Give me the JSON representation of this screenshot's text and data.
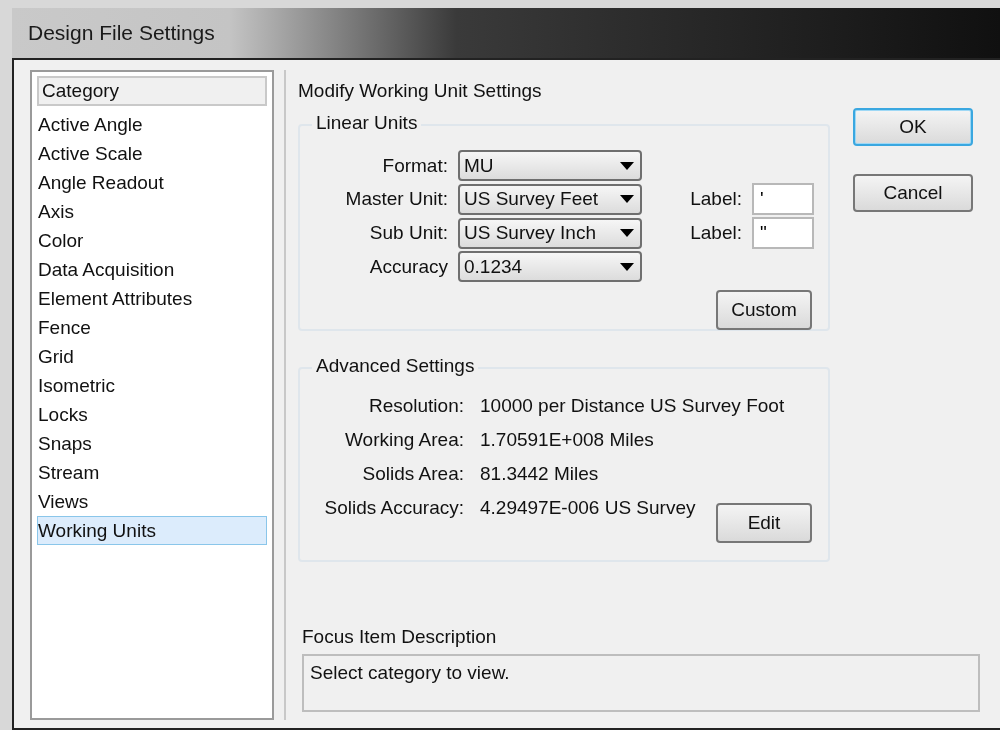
{
  "window": {
    "title": "Design File Settings"
  },
  "category_list": {
    "header": "Category",
    "items": [
      {
        "label": "Active Angle",
        "selected": false
      },
      {
        "label": "Active Scale",
        "selected": false
      },
      {
        "label": "Angle Readout",
        "selected": false
      },
      {
        "label": "Axis",
        "selected": false
      },
      {
        "label": "Color",
        "selected": false
      },
      {
        "label": "Data Acquisition",
        "selected": false
      },
      {
        "label": "Element Attributes",
        "selected": false
      },
      {
        "label": "Fence",
        "selected": false
      },
      {
        "label": "Grid",
        "selected": false
      },
      {
        "label": "Isometric",
        "selected": false
      },
      {
        "label": "Locks",
        "selected": false
      },
      {
        "label": "Snaps",
        "selected": false
      },
      {
        "label": "Stream",
        "selected": false
      },
      {
        "label": "Views",
        "selected": false
      },
      {
        "label": "Working Units",
        "selected": true
      }
    ]
  },
  "panel": {
    "heading": "Modify Working Unit Settings",
    "linear_units": {
      "title": "Linear Units",
      "dropdowns": [
        {
          "label": "Format:",
          "value": "MU"
        },
        {
          "label": "Master Unit:",
          "value": "US Survey Feet"
        },
        {
          "label": "Sub Unit:",
          "value": "US Survey Inch"
        },
        {
          "label": "Accuracy",
          "value": "0.1234"
        }
      ],
      "label_fields": [
        {
          "label": "Label:",
          "value": "'"
        },
        {
          "label": "Label:",
          "value": "\""
        }
      ],
      "custom_button": "Custom"
    },
    "advanced_settings": {
      "title": "Advanced Settings",
      "rows": [
        {
          "label": "Resolution:",
          "value": "10000 per Distance US Survey Foot"
        },
        {
          "label": "Working Area:",
          "value": "1.70591E+008 Miles"
        },
        {
          "label": "Solids Area:",
          "value": "81.3442 Miles"
        },
        {
          "label": "Solids Accuracy:",
          "value": "4.29497E-006 US Survey"
        }
      ],
      "edit_button": "Edit"
    },
    "focus_item": {
      "title": "Focus Item Description",
      "text": "Select category to view."
    }
  },
  "buttons": [
    {
      "label": "OK",
      "default": true
    },
    {
      "label": "Cancel",
      "default": false
    }
  ]
}
